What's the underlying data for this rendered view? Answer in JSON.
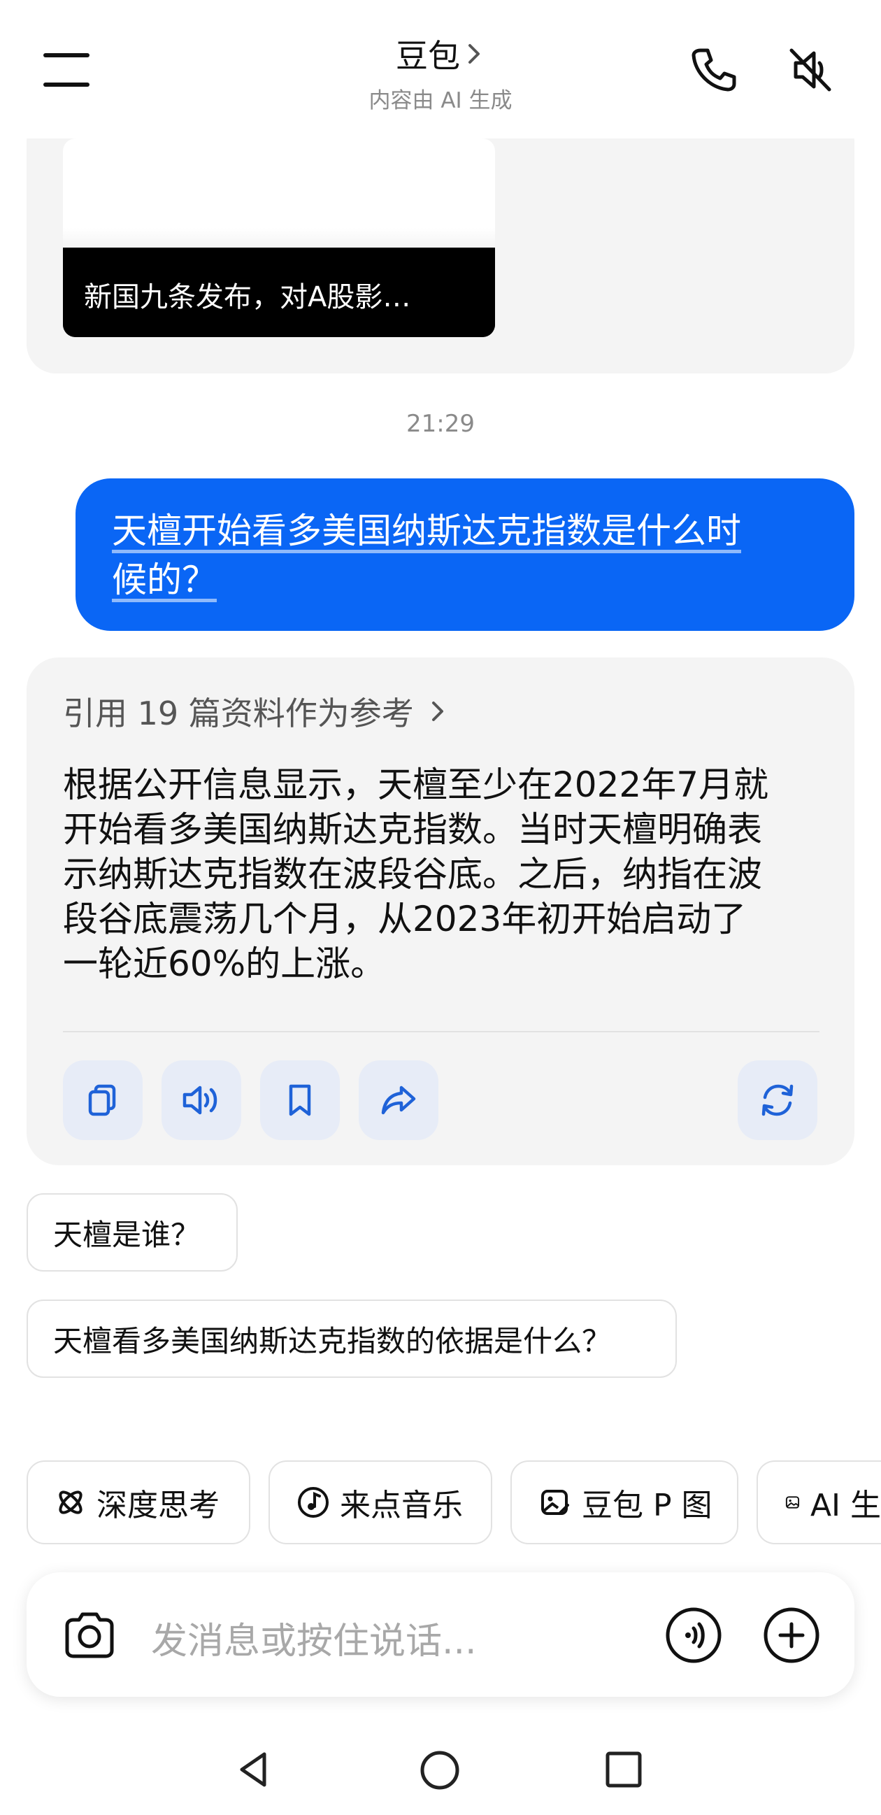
{
  "header": {
    "title": "豆包",
    "subtitle": "内容由 AI 生成",
    "icons": [
      "menu-icon",
      "chevron-right-icon",
      "phone-icon",
      "mute-speaker-icon"
    ]
  },
  "previous_card": {
    "caption": "新国九条发布，对A股影…"
  },
  "timestamp": "21:29",
  "user_message": {
    "line1": "天檀开始看多美国纳斯达克指数是什么时",
    "line2": "候的？"
  },
  "answer": {
    "reference_label": "引用 19 篇资料作为参考",
    "lines": [
      "根据公开信息显示，天檀至少在2022年7月就",
      "开始看多美国纳斯达克指数。当时天檀明确表",
      "示纳斯达克指数在波段谷底。之后，纳指在波",
      "段谷底震荡几个月，从2023年初开始启动了",
      "一轮近60%的上涨。"
    ],
    "actions": [
      "copy-icon",
      "speaker-icon",
      "bookmark-icon",
      "share-icon",
      "regenerate-icon"
    ]
  },
  "suggestions": [
    "天檀是谁？",
    "天檀看多美国纳斯达克指数的依据是什么？"
  ],
  "chips": [
    {
      "label": "深度思考",
      "icon": "deep-think-icon"
    },
    {
      "label": "来点音乐",
      "icon": "music-icon"
    },
    {
      "label": "豆包 P 图",
      "icon": "photo-edit-icon"
    },
    {
      "label": "AI 生",
      "icon": "image-icon"
    }
  ],
  "input": {
    "placeholder": "发消息或按住说话..."
  },
  "colors": {
    "accent": "#0a66f5",
    "card_bg": "#f4f4f4",
    "action_bg": "#e7ecf7",
    "action_icon": "#1f62d8"
  }
}
